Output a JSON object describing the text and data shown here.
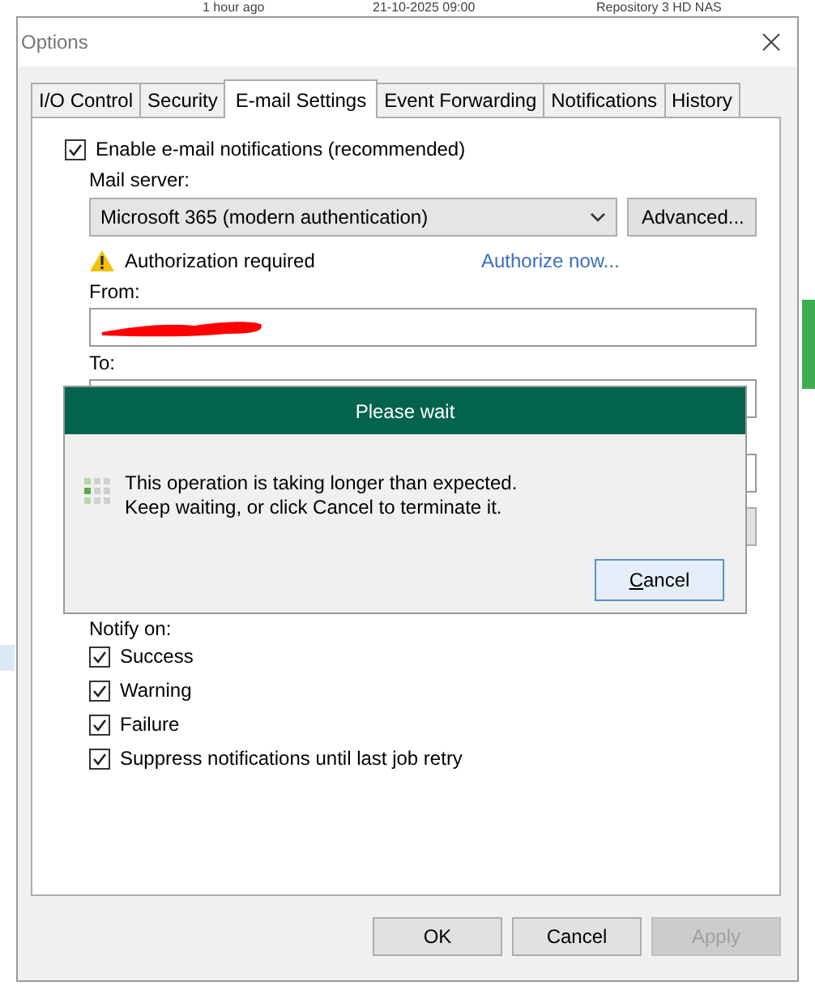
{
  "background": {
    "cells": [
      "1 hour ago",
      "21-10-2025 09:00",
      "Repository 3 HD NAS"
    ]
  },
  "window": {
    "title": "Options"
  },
  "tabs": [
    {
      "label": "I/O Control",
      "selected": false
    },
    {
      "label": "Security",
      "selected": false
    },
    {
      "label": "E-mail Settings",
      "selected": true
    },
    {
      "label": "Event Forwarding",
      "selected": false
    },
    {
      "label": "Notifications",
      "selected": false
    },
    {
      "label": "History",
      "selected": false
    }
  ],
  "email": {
    "enable": {
      "label": "Enable e-mail notifications (recommended)",
      "checked": true
    },
    "mail_server_label": "Mail server:",
    "mail_server": "Microsoft 365 (modern authentication)",
    "advanced_button": "Advanced...",
    "auth_warning": "Authorization required",
    "authorize_link": "Authorize now...",
    "from_label": "From:",
    "to_label": "To:",
    "notify_label": "Notify on:",
    "notify": [
      {
        "label": "Success",
        "checked": true
      },
      {
        "label": "Warning",
        "checked": true
      },
      {
        "label": "Failure",
        "checked": true
      },
      {
        "label": "Suppress notifications until last job retry",
        "checked": true
      }
    ]
  },
  "buttons": [
    {
      "label": "OK",
      "disabled": false
    },
    {
      "label": "Cancel",
      "disabled": false
    },
    {
      "label": "Apply",
      "disabled": true
    }
  ],
  "wait_dialog": {
    "title": "Please wait",
    "message_lines": [
      "This operation is taking longer than expected.",
      "Keep waiting, or click Cancel to terminate it."
    ],
    "cancel_button": "Cancel"
  }
}
